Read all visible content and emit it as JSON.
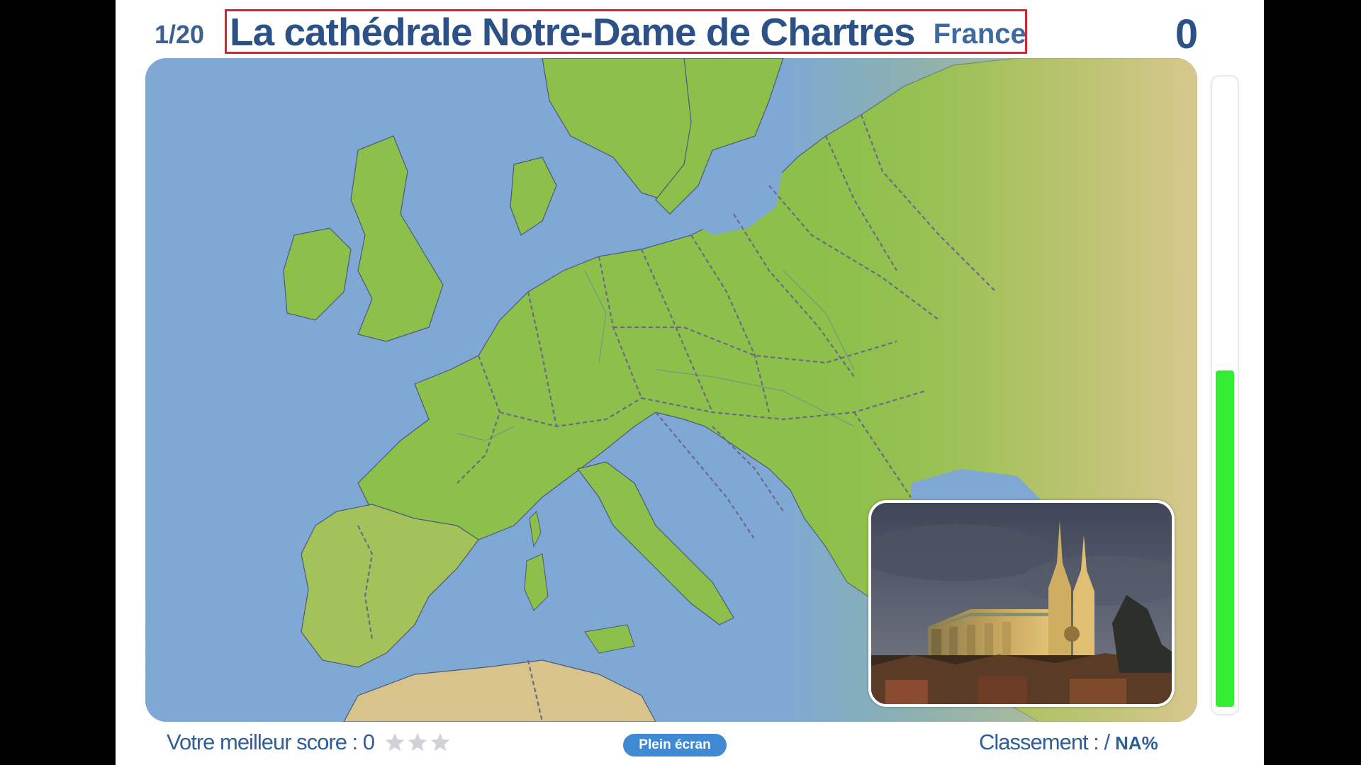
{
  "header": {
    "counter": "1/20",
    "question_title": "La cathédrale Notre-Dame de Chartres",
    "question_country": "France",
    "score": "0"
  },
  "map": {
    "credit": "towns_eur_tresors",
    "sea_color": "#7fa9d4",
    "land_color": "#8cc04a",
    "border_color": "#6a6a88"
  },
  "photo": {
    "subject": "Cathédrale de Chartres"
  },
  "timer": {
    "level": 0.54,
    "color": "#33ee33"
  },
  "footer": {
    "best_score_label": "Votre meilleur score : 0",
    "stars_total": 3,
    "stars_filled": 0,
    "fullscreen_label": "Plein écran",
    "ranking_label": "Classement : /",
    "ranking_value": "NA%"
  },
  "icons": {
    "star": "star-icon"
  }
}
